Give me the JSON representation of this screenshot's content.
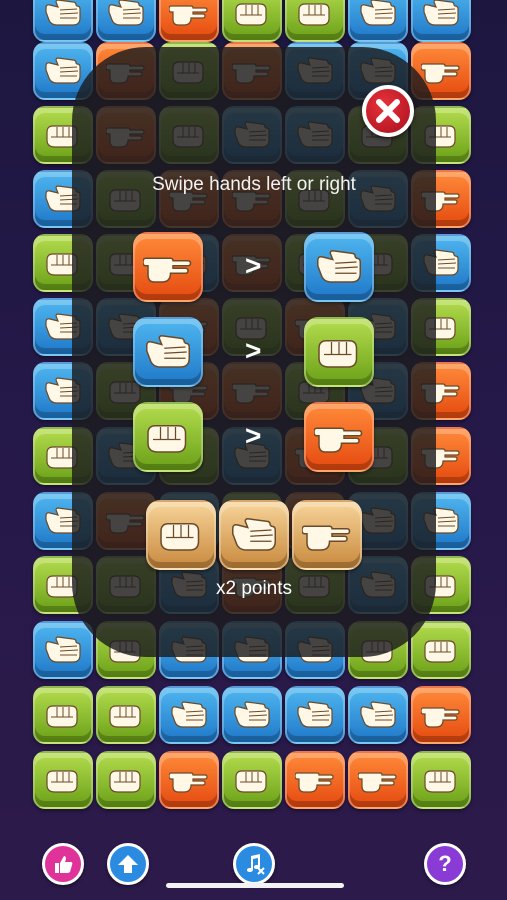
{
  "tutorial": {
    "instruction": "Swipe hands left or right",
    "rules": [
      {
        "winner": "scissors",
        "symbol": ">",
        "loser": "paper"
      },
      {
        "winner": "paper",
        "symbol": ">",
        "loser": "rock"
      },
      {
        "winner": "rock",
        "symbol": ">",
        "loser": "scissors"
      }
    ],
    "bonus_tiles": [
      "rock",
      "paper",
      "scissors"
    ],
    "bonus_label": "x2 points"
  },
  "board_rows": [
    [
      "paper",
      "paper",
      "scissors",
      "rock",
      "rock",
      "paper",
      "paper"
    ],
    [
      "paper",
      "scissors",
      "rock",
      "scissors",
      "paper",
      "paper",
      "scissors"
    ],
    [
      "rock",
      "scissors",
      "rock",
      "paper",
      "paper",
      "rock",
      "rock"
    ],
    [
      "paper",
      "rock",
      "scissors",
      "scissors",
      "rock",
      "paper",
      "scissors"
    ],
    [
      "rock",
      "rock",
      "paper",
      "scissors",
      "rock",
      "rock",
      "paper"
    ],
    [
      "paper",
      "paper",
      "scissors",
      "rock",
      "scissors",
      "paper",
      "rock"
    ],
    [
      "paper",
      "rock",
      "scissors",
      "scissors",
      "rock",
      "paper",
      "scissors"
    ],
    [
      "rock",
      "paper",
      "rock",
      "paper",
      "scissors",
      "rock",
      "scissors"
    ],
    [
      "paper",
      "scissors",
      "paper",
      "rock",
      "scissors",
      "paper",
      "paper"
    ],
    [
      "rock",
      "rock",
      "paper",
      "scissors",
      "rock",
      "paper",
      "rock"
    ],
    [
      "paper",
      "rock",
      "paper",
      "paper",
      "paper",
      "rock",
      "rock"
    ],
    [
      "rock",
      "rock",
      "paper",
      "paper",
      "paper",
      "paper",
      "scissors"
    ],
    [
      "rock",
      "rock",
      "scissors",
      "rock",
      "scissors",
      "scissors",
      "rock"
    ]
  ],
  "bottom_bar": {
    "buttons": [
      {
        "name": "like-button",
        "icon": "thumbs-up-icon",
        "color": "#e0339a"
      },
      {
        "name": "share-button",
        "icon": "arrow-up-icon",
        "color": "#2b8be0"
      },
      {
        "name": "music-toggle-button",
        "icon": "music-muted-icon",
        "color": "#2b8be0"
      },
      {
        "name": "help-button",
        "icon": "question-icon",
        "color": "#8a3bd6",
        "label": "?"
      }
    ]
  },
  "colors": {
    "paper": "#2f93dd",
    "rock": "#8cc136",
    "scissors": "#f26a22",
    "close": "#d21f2b"
  }
}
